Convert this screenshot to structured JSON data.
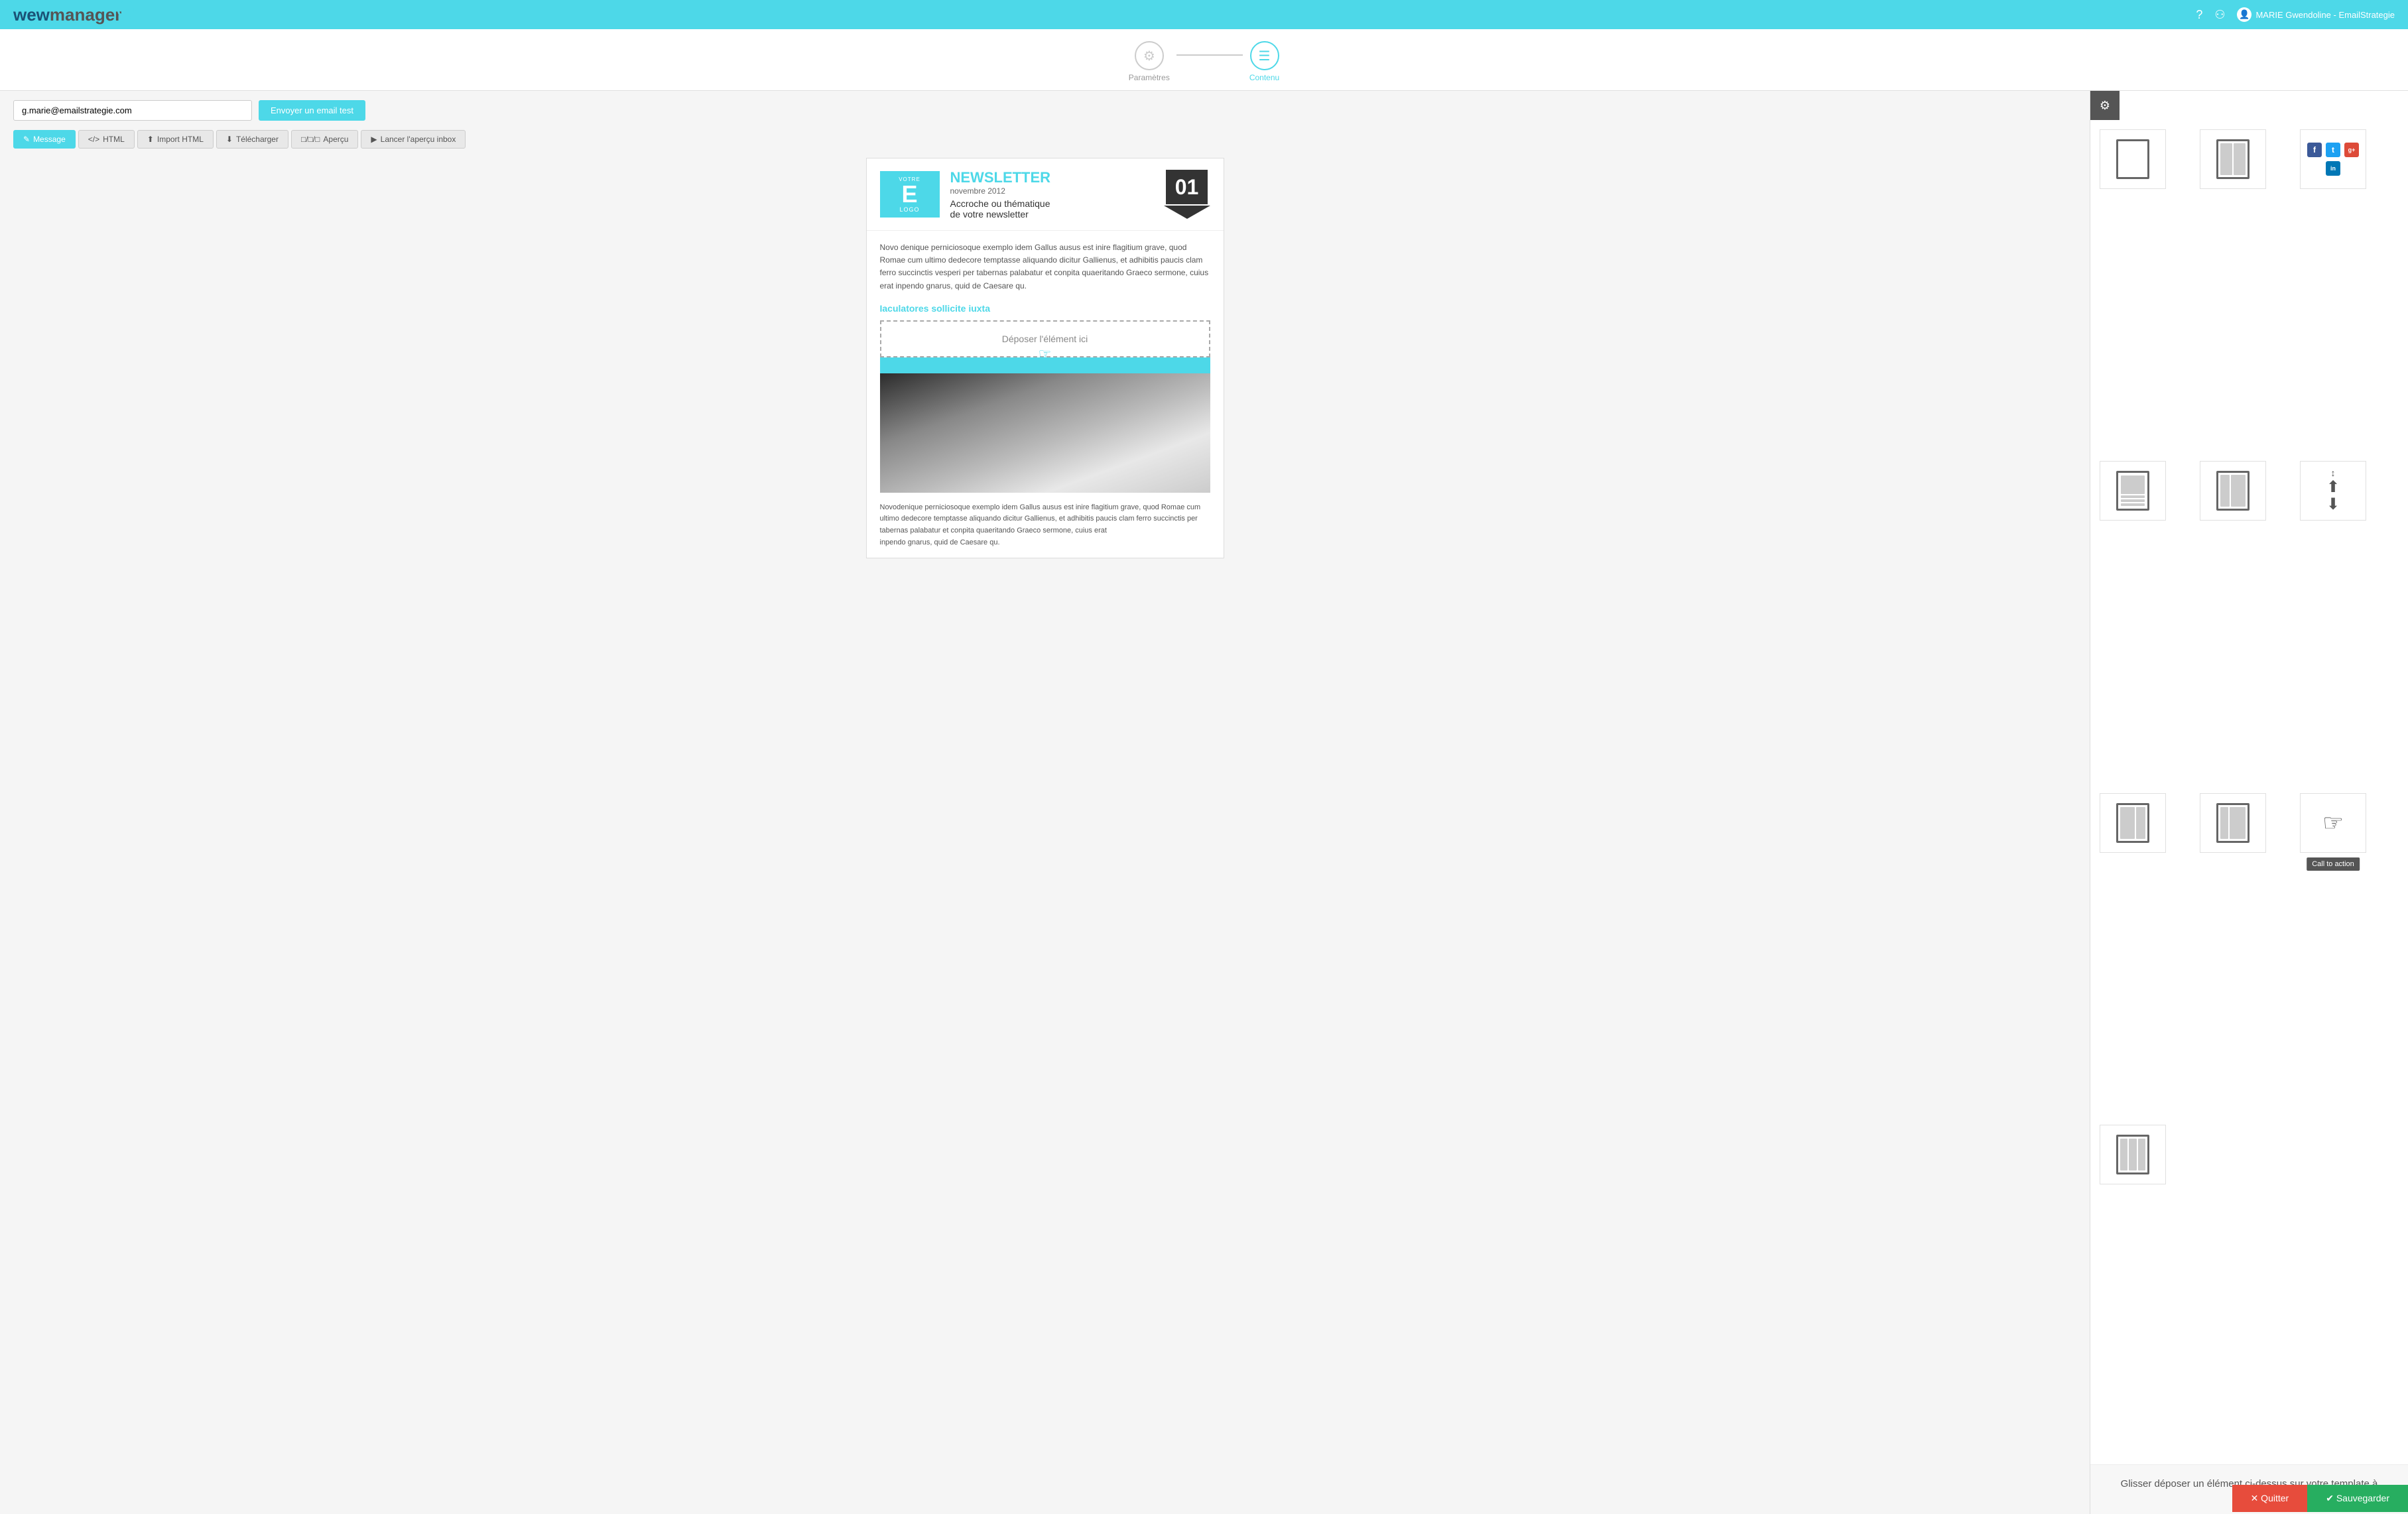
{
  "app": {
    "title": "wewmanager"
  },
  "nav": {
    "help_icon": "?",
    "users_icon": "👥",
    "user_name": "MARIE Gwendoline - EmailStrategie"
  },
  "steps": {
    "step1_label": "Paramètres",
    "step2_label": "Contenu"
  },
  "test_bar": {
    "input_value": "g.marie@emailstrategie.com",
    "input_placeholder": "g.marie@emailstrategie.com",
    "send_button_label": "Envoyer un email test"
  },
  "toolbar": {
    "tabs": [
      {
        "id": "message",
        "label": "Message",
        "icon": "✎",
        "active": true
      },
      {
        "id": "html",
        "label": "HTML",
        "icon": "</>",
        "active": false
      },
      {
        "id": "import",
        "label": "Import HTML",
        "icon": "⬆",
        "active": false
      },
      {
        "id": "download",
        "label": "Télécharger",
        "icon": "⬇",
        "active": false
      },
      {
        "id": "preview",
        "label": "Aperçu",
        "icon": "□",
        "active": false
      },
      {
        "id": "inbox",
        "label": "Lancer l'aperçu inbox",
        "icon": "▶",
        "active": false
      }
    ]
  },
  "newsletter": {
    "logo_letter": "E",
    "logo_sub": "VOTRE LOGO",
    "title": "NEWSLETTER",
    "subtitle": "novembre 2012",
    "tagline_line1": "Accroche ou thématique",
    "tagline_line2": "de votre newsletter",
    "number": "01",
    "body_text": "Novo denique perniciosoque exemplo idem Gallus ausus est inire flagitium grave, quod Romae cum ultimo dedecore temptasse aliquando dicitur Gallienus, et adhibitis paucis clam ferro succinctis vesperi per tabernas palabatur et conpita quaeritando Graeco sermone, cuius erat inpendo gnarus, quid de Caesare qu.",
    "link_text": "Iaculatores sollicite iuxta",
    "drop_zone_text": "Déposer l'élément ici",
    "footer_text": "Novodenique perniciosoque exemplo idem Gallus ausus est inire flagitium grave, quod Romae cum ultimo dedecore temptasse aliquando dicitur Gallienus, et adhibitis paucis clam ferro succinctis per tabernas palabatur et conpita quaeritando Graeco sermone, cuius erat\ninpendo gnarus, quid de Caesare qu."
  },
  "right_panel": {
    "elements": [
      {
        "id": "full-column",
        "label": "Colonne entière",
        "type": "full"
      },
      {
        "id": "two-column",
        "label": "2 colonnes",
        "type": "2col"
      },
      {
        "id": "social",
        "label": "Réseaux sociaux",
        "type": "social"
      },
      {
        "id": "image-text",
        "label": "Image + texte",
        "type": "img"
      },
      {
        "id": "two-col-alt",
        "label": "2 colonnes alt",
        "type": "2col-alt"
      },
      {
        "id": "resize",
        "label": "Redimensionner",
        "type": "resize"
      },
      {
        "id": "half-left",
        "label": "Moitié gauche",
        "type": "half-left"
      },
      {
        "id": "half-right",
        "label": "Moitié droite",
        "type": "half-right"
      },
      {
        "id": "cta",
        "label": "Call to action",
        "type": "cta"
      },
      {
        "id": "three-col",
        "label": "3 colonnes",
        "type": "3col"
      }
    ],
    "cta_tooltip": "Call to action",
    "drag_hint": "Glisser déposer un élément ci-dessus sur votre template à gauche"
  },
  "social_icons": [
    {
      "name": "facebook",
      "class": "si-fb",
      "label": "f"
    },
    {
      "name": "twitter",
      "class": "si-tw",
      "label": "t"
    },
    {
      "name": "google-plus",
      "class": "si-gp",
      "label": "g+"
    },
    {
      "name": "linkedin",
      "class": "si-li",
      "label": "in"
    }
  ],
  "bottom": {
    "quit_label": "✕ Quitter",
    "save_label": "✔ Sauvegarder"
  }
}
